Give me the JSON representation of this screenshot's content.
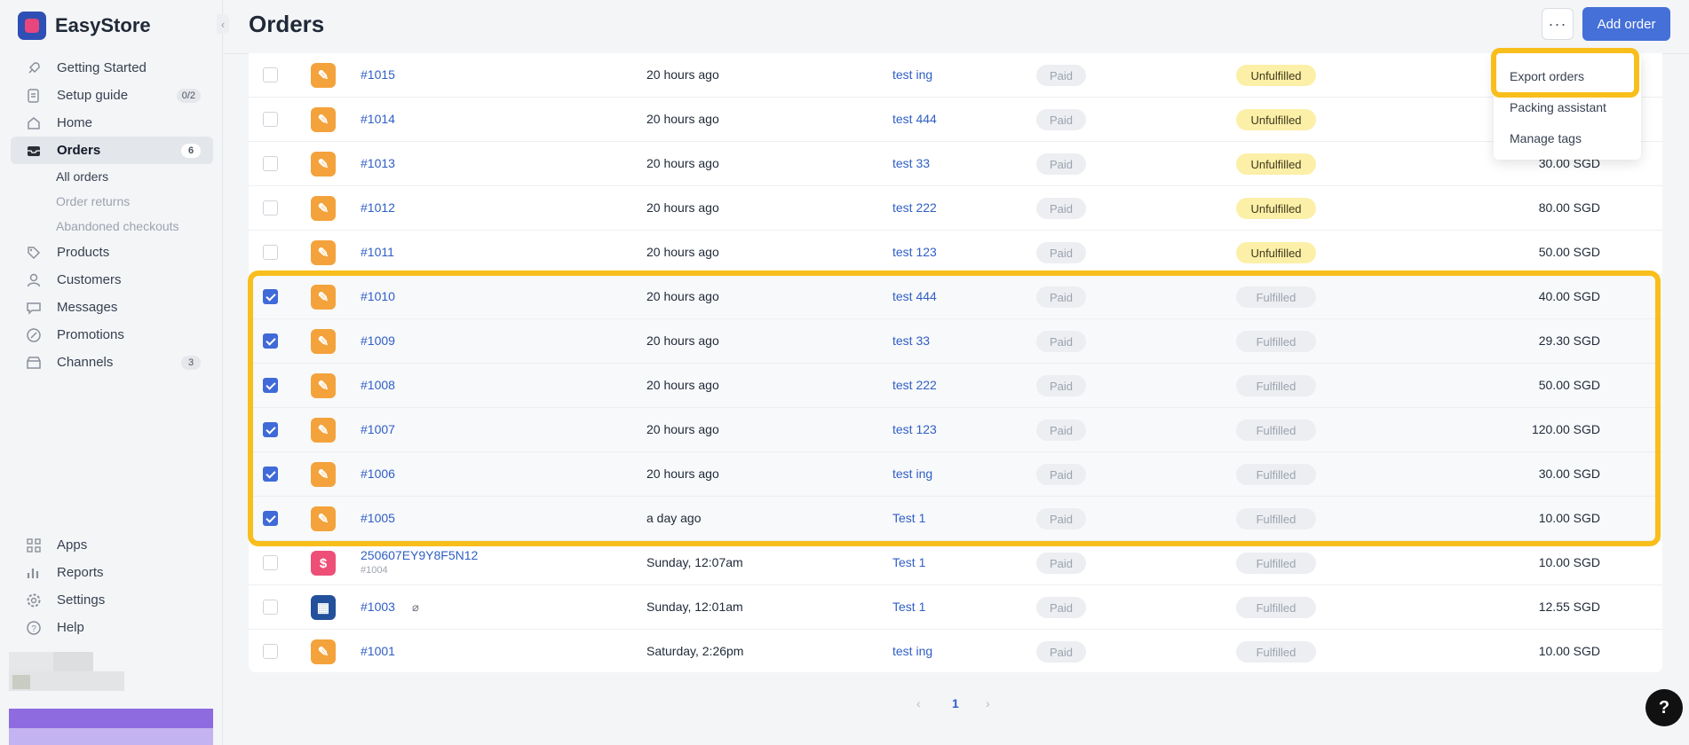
{
  "brand": {
    "name": "EasyStore"
  },
  "page": {
    "title": "Orders"
  },
  "header": {
    "more_label": "···",
    "add_label": "Add order"
  },
  "sidebar": {
    "items": [
      {
        "label": "Getting Started",
        "icon": "rocket-icon"
      },
      {
        "label": "Setup guide",
        "icon": "checklist-icon",
        "badge": "0/2"
      },
      {
        "label": "Home",
        "icon": "home-icon"
      },
      {
        "label": "Orders",
        "icon": "inbox-icon",
        "badge": "6",
        "active": true
      },
      {
        "label": "Products",
        "icon": "tag-icon"
      },
      {
        "label": "Customers",
        "icon": "person-icon"
      },
      {
        "label": "Messages",
        "icon": "chat-icon"
      },
      {
        "label": "Promotions",
        "icon": "percent-icon"
      },
      {
        "label": "Channels",
        "icon": "store-icon",
        "badge": "3"
      },
      {
        "label": "Apps",
        "icon": "apps-icon"
      },
      {
        "label": "Reports",
        "icon": "bar-chart-icon"
      },
      {
        "label": "Settings",
        "icon": "gear-icon"
      },
      {
        "label": "Help",
        "icon": "question-icon"
      }
    ],
    "orders_sub": [
      {
        "label": "All orders"
      },
      {
        "label": "Order returns"
      },
      {
        "label": "Abandoned checkouts"
      }
    ]
  },
  "dropdown": {
    "items": [
      {
        "label": "Export orders"
      },
      {
        "label": "Packing assistant"
      },
      {
        "label": "Manage tags"
      }
    ]
  },
  "orders": [
    {
      "id": "#1015",
      "date": "20 hours ago",
      "customer": "test ing",
      "payment": "Paid",
      "fulfillment": "Unfulfilled",
      "total": "",
      "checked": false,
      "source": "manual"
    },
    {
      "id": "#1014",
      "date": "20 hours ago",
      "customer": "test 444",
      "payment": "Paid",
      "fulfillment": "Unfulfilled",
      "total": "",
      "checked": false,
      "source": "manual"
    },
    {
      "id": "#1013",
      "date": "20 hours ago",
      "customer": "test 33",
      "payment": "Paid",
      "fulfillment": "Unfulfilled",
      "total": "30.00 SGD",
      "checked": false,
      "source": "manual"
    },
    {
      "id": "#1012",
      "date": "20 hours ago",
      "customer": "test 222",
      "payment": "Paid",
      "fulfillment": "Unfulfilled",
      "total": "80.00 SGD",
      "checked": false,
      "source": "manual"
    },
    {
      "id": "#1011",
      "date": "20 hours ago",
      "customer": "test 123",
      "payment": "Paid",
      "fulfillment": "Unfulfilled",
      "total": "50.00 SGD",
      "checked": false,
      "source": "manual"
    },
    {
      "id": "#1010",
      "date": "20 hours ago",
      "customer": "test 444",
      "payment": "Paid",
      "fulfillment": "Fulfilled",
      "total": "40.00 SGD",
      "checked": true,
      "source": "manual"
    },
    {
      "id": "#1009",
      "date": "20 hours ago",
      "customer": "test 33",
      "payment": "Paid",
      "fulfillment": "Fulfilled",
      "total": "29.30 SGD",
      "checked": true,
      "source": "manual"
    },
    {
      "id": "#1008",
      "date": "20 hours ago",
      "customer": "test 222",
      "payment": "Paid",
      "fulfillment": "Fulfilled",
      "total": "50.00 SGD",
      "checked": true,
      "source": "manual"
    },
    {
      "id": "#1007",
      "date": "20 hours ago",
      "customer": "test 123",
      "payment": "Paid",
      "fulfillment": "Fulfilled",
      "total": "120.00 SGD",
      "checked": true,
      "source": "manual"
    },
    {
      "id": "#1006",
      "date": "20 hours ago",
      "customer": "test ing",
      "payment": "Paid",
      "fulfillment": "Fulfilled",
      "total": "30.00 SGD",
      "checked": true,
      "source": "manual"
    },
    {
      "id": "#1005",
      "date": "a day ago",
      "customer": "Test 1",
      "payment": "Paid",
      "fulfillment": "Fulfilled",
      "total": "10.00 SGD",
      "checked": true,
      "source": "manual"
    },
    {
      "id": "250607EY9Y8F5N12",
      "sub_id": "#1004",
      "date": "Sunday, 12:07am",
      "customer": "Test 1",
      "payment": "Paid",
      "fulfillment": "Fulfilled",
      "total": "10.00 SGD",
      "checked": false,
      "source": "pos"
    },
    {
      "id": "#1003",
      "date": "Sunday, 12:01am",
      "customer": "Test 1",
      "payment": "Paid",
      "fulfillment": "Fulfilled",
      "total": "12.55 SGD",
      "checked": false,
      "source": "store",
      "has_attachment": true
    },
    {
      "id": "#1001",
      "date": "Saturday, 2:26pm",
      "customer": "test ing",
      "payment": "Paid",
      "fulfillment": "Fulfilled",
      "total": "10.00 SGD",
      "checked": false,
      "source": "manual"
    }
  ],
  "pagination": {
    "prev": "‹",
    "current": "1",
    "next": "›"
  },
  "help_button": {
    "label": "?"
  },
  "colors": {
    "accent": "#4470d8",
    "highlight": "#f8be1b",
    "unfulfilled": "#fcefa8"
  }
}
